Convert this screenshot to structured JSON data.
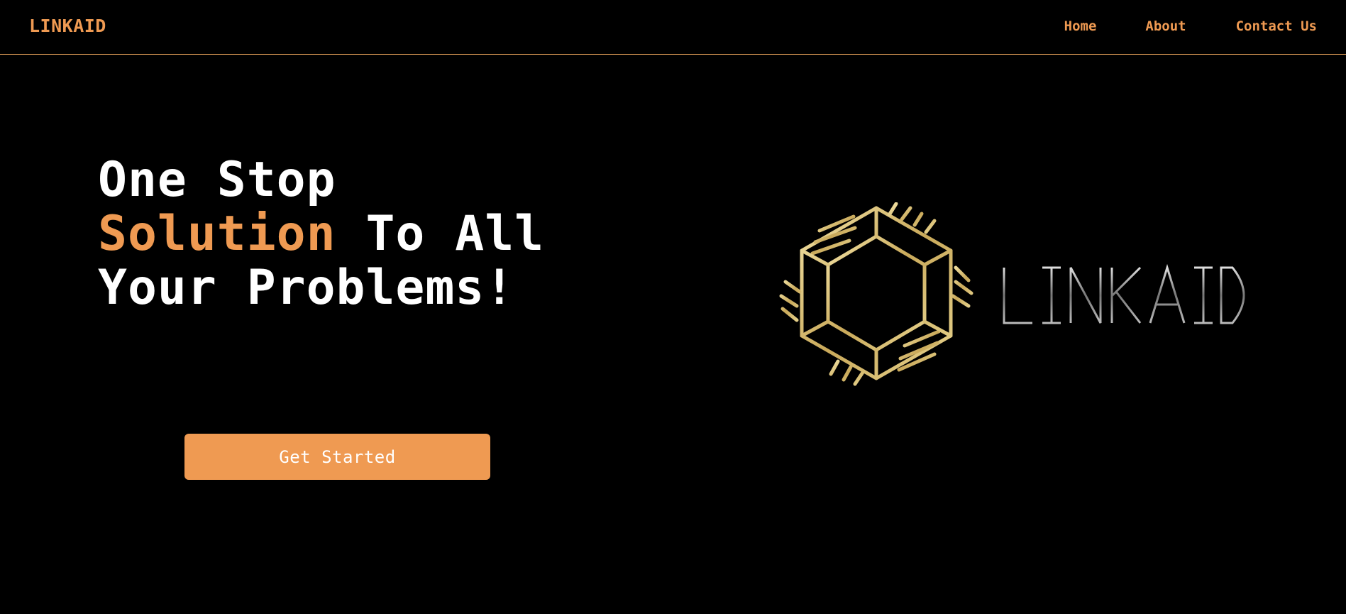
{
  "brand": "LINKAID",
  "nav": {
    "home": "Home",
    "about": "About",
    "contact": "Contact Us"
  },
  "hero": {
    "line1": "One Stop",
    "line2_accent": "Solution",
    "line2_rest": " To All",
    "line3": "Your Problems!",
    "cta_label": "Get Started"
  },
  "logo": {
    "icon": "hands-circle-icon",
    "wordmark": "LINKAID"
  },
  "colors": {
    "background": "#000000",
    "accent": "#ef9a52",
    "gold": "#d9c27a",
    "text": "#ffffff"
  }
}
